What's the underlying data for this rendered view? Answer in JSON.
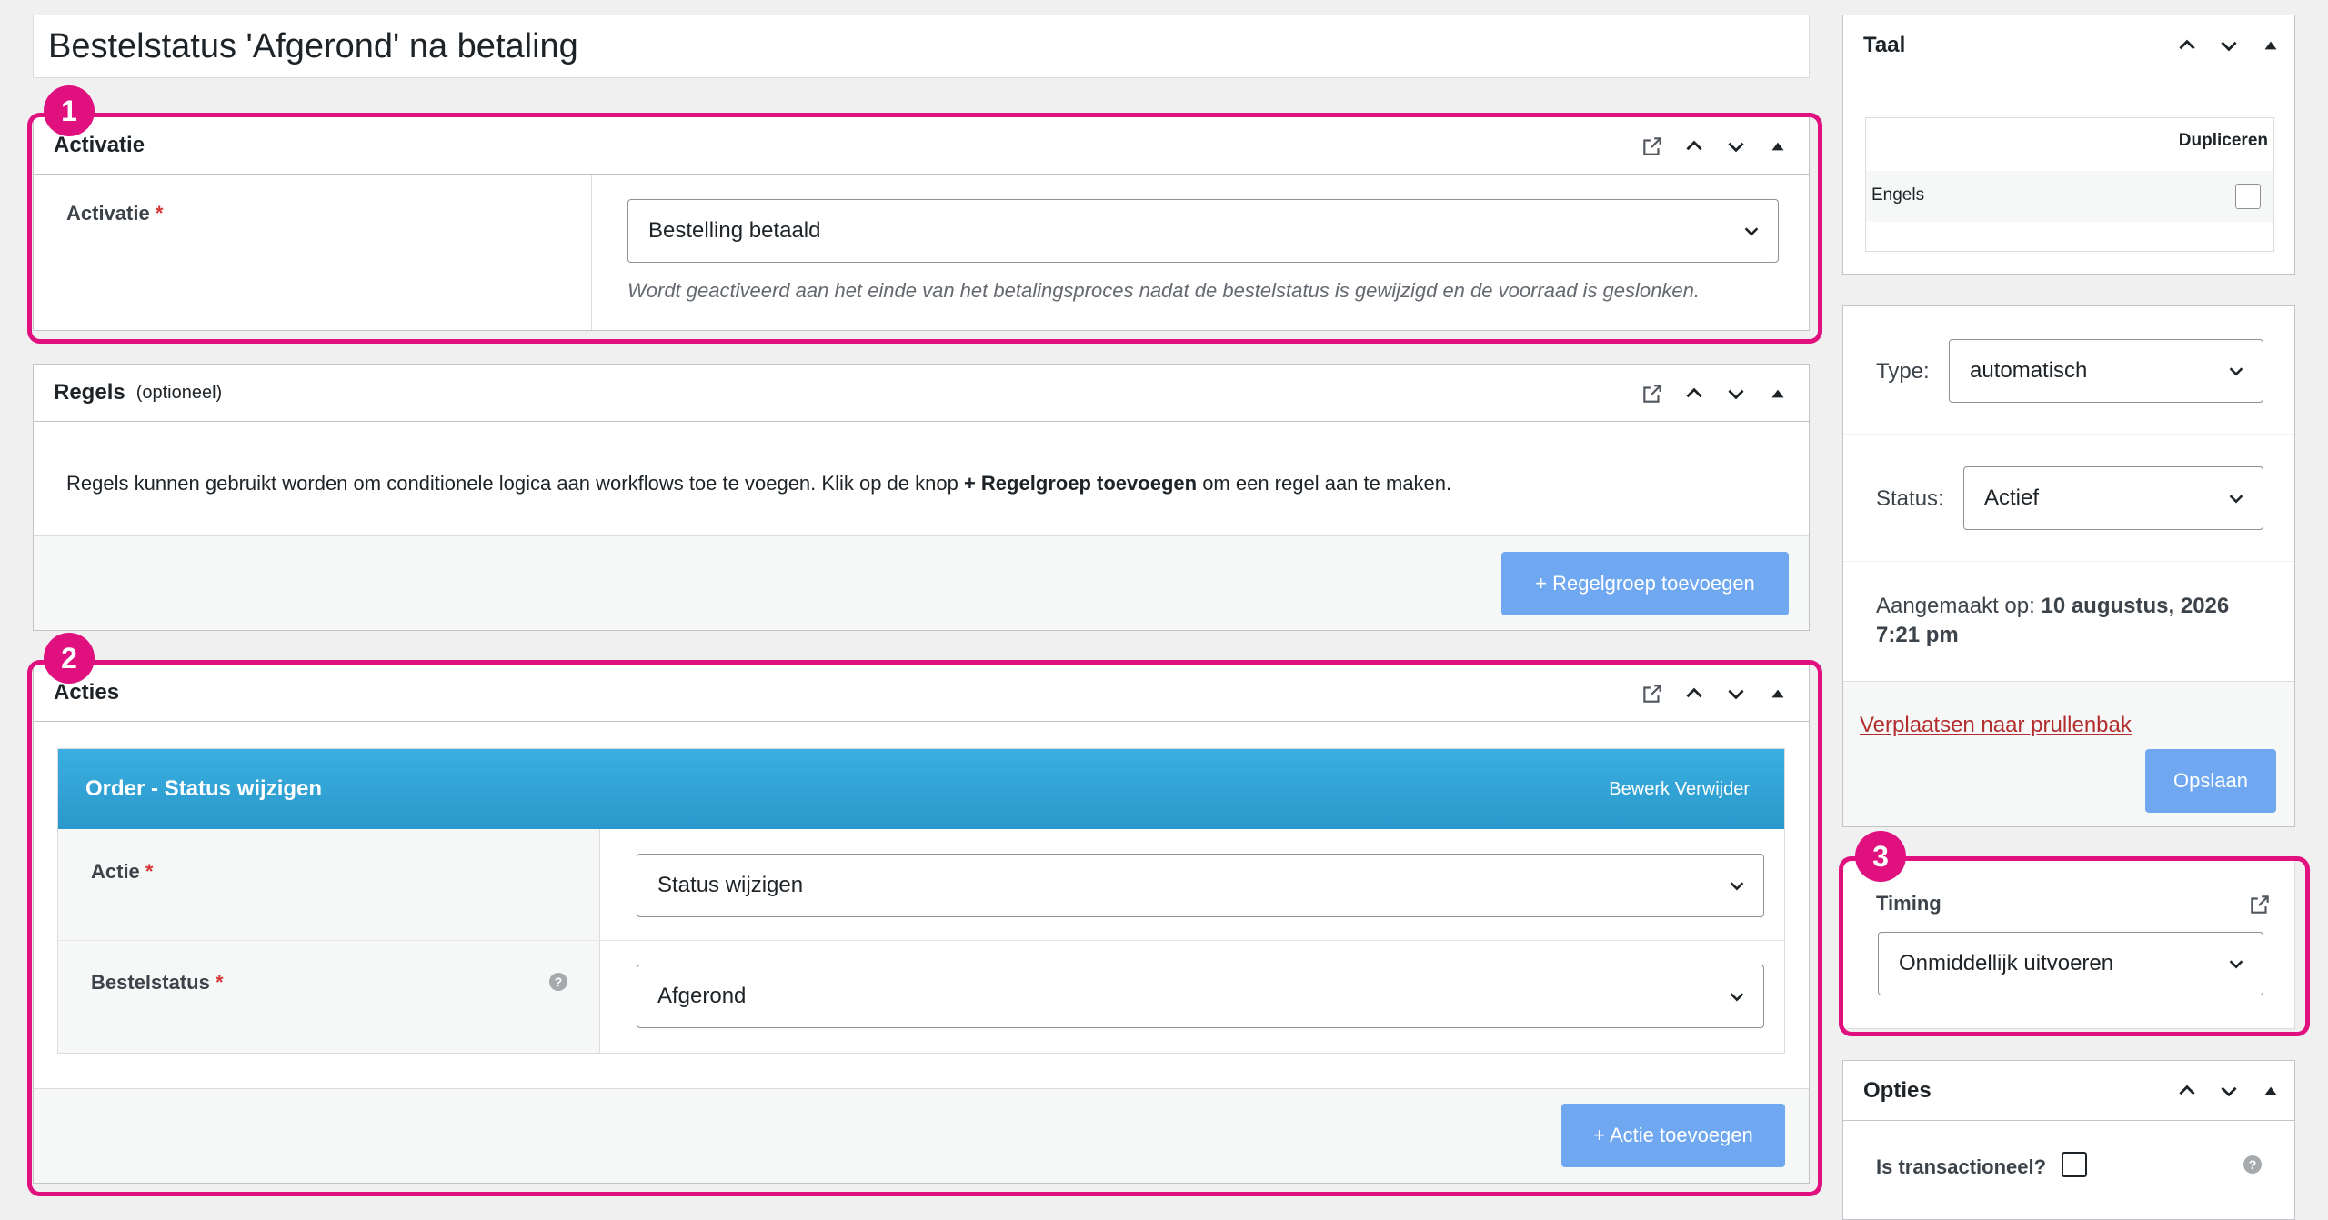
{
  "page": {
    "title": "Bestelstatus 'Afgerond' na betaling"
  },
  "activatie": {
    "title": "Activatie",
    "field_label": "Activatie",
    "required_mark": "*",
    "selected": "Bestelling betaald",
    "description": "Wordt geactiveerd aan het einde van het betalingsproces nadat de bestelstatus is gewijzigd en de voorraad is geslonken."
  },
  "regels": {
    "title": "Regels",
    "subtitle": "(optioneel)",
    "text_before": "Regels kunnen gebruikt worden om conditionele logica aan workflows toe te voegen. Klik op de knop ",
    "text_bold": "+ Regelgroep toevoegen",
    "text_after": " om een regel aan te maken.",
    "add_button": "+ Regelgroep toevoegen"
  },
  "acties": {
    "title": "Acties",
    "action_title": "Order - Status wijzigen",
    "edit_link": "Bewerk",
    "delete_link": "Verwijder",
    "action_label": "Actie",
    "action_selected": "Status wijzigen",
    "status_label": "Bestelstatus",
    "status_selected": "Afgerond",
    "required_mark": "*",
    "help_glyph": "?",
    "add_button": "+ Actie toevoegen"
  },
  "taal": {
    "title": "Taal",
    "column_header": "Dupliceren",
    "row_label": "Engels"
  },
  "publish": {
    "type_label": "Type:",
    "type_value": "automatisch",
    "status_label": "Status:",
    "status_value": "Actief",
    "created_label": "Aangemaakt op:",
    "created_value_line1": "10 augustus, 2026",
    "created_value_line2": "7:21 pm",
    "trash_link": "Verplaatsen naar prullenbak",
    "save_button": "Opslaan"
  },
  "timing": {
    "title": "Timing",
    "selected": "Onmiddellijk uitvoeren"
  },
  "opties": {
    "title": "Opties",
    "transactional_label": "Is transactioneel?",
    "help_glyph": "?"
  },
  "badges": {
    "one": "1",
    "two": "2",
    "three": "3"
  },
  "colors": {
    "highlight": "#e0107e",
    "action_header": "#2ea2d4",
    "primary_button": "#6fa8f1",
    "trash_link": "#b32d2e"
  }
}
